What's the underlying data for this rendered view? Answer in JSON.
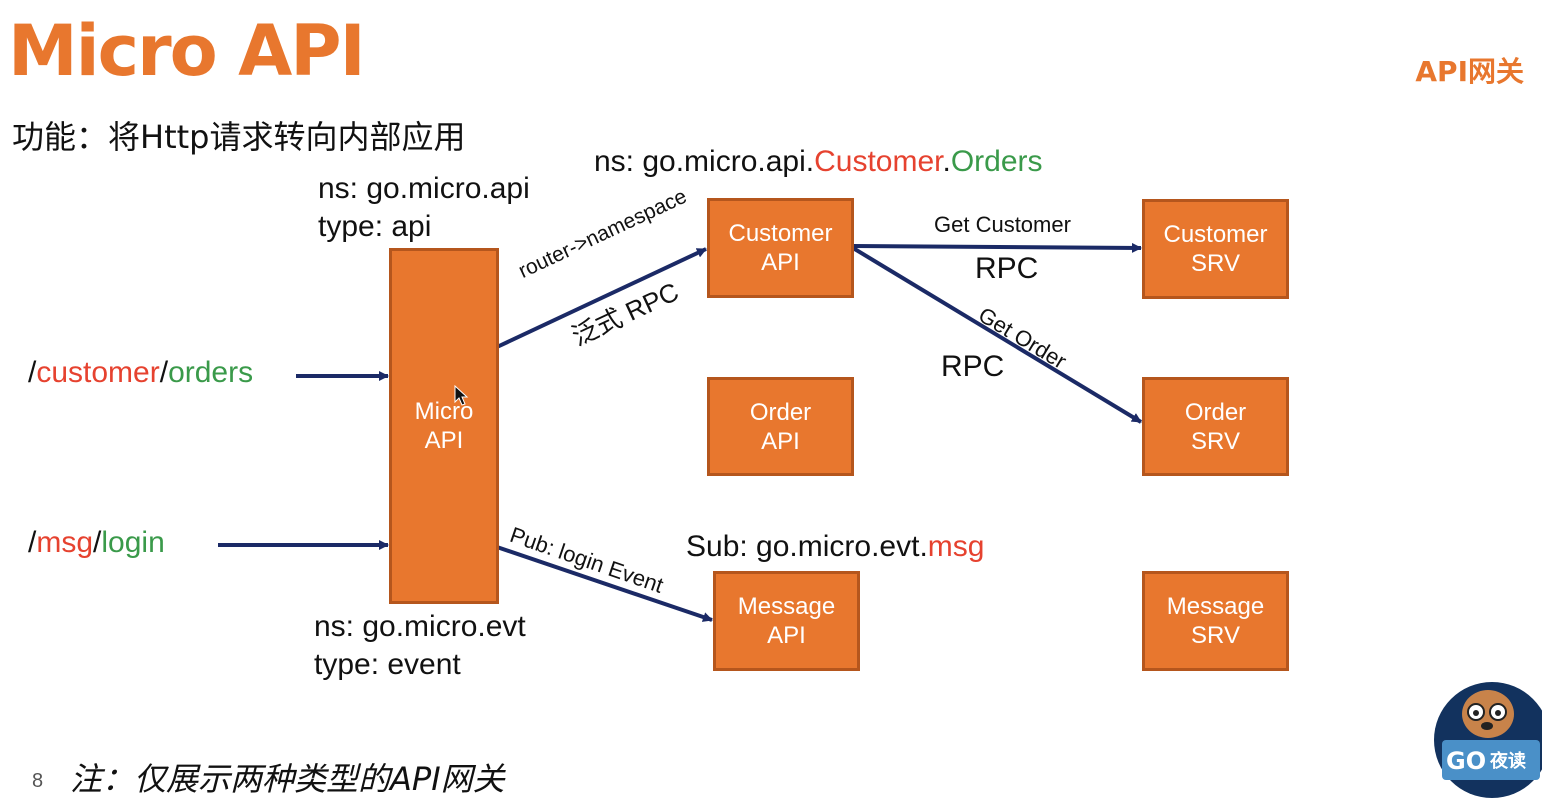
{
  "title": "Micro API",
  "badge": "API网关",
  "function_text": "功能：将Http请求转向内部应用",
  "routes": {
    "customer": {
      "slash1": "/",
      "part1": "customer",
      "slash2": "/",
      "part2": "orders"
    },
    "msg": {
      "slash1": "/",
      "part1": "msg",
      "slash2": "/",
      "part2": "login"
    }
  },
  "api_ns": {
    "ns": "ns: go.micro.api",
    "type": "type: api"
  },
  "evt_ns": {
    "ns": "ns: go.micro.evt",
    "type": "type: event"
  },
  "customer_ns": {
    "prefix": "ns: go.micro.api.",
    "customer": "Customer",
    "dot": ".",
    "orders": "Orders"
  },
  "sub": {
    "prefix": "Sub: go.micro.evt.",
    "msg": "msg"
  },
  "boxes": {
    "micro_api": [
      "Micro",
      "API"
    ],
    "customer_api": [
      "Customer",
      "API"
    ],
    "order_api": [
      "Order",
      "API"
    ],
    "message_api": [
      "Message",
      "API"
    ],
    "customer_srv": [
      "Customer",
      "SRV"
    ],
    "order_srv": [
      "Order",
      "SRV"
    ],
    "message_srv": [
      "Message",
      "SRV"
    ]
  },
  "edges": {
    "router": "router->namespace",
    "generic_rpc": "泛式 RPC",
    "get_customer": "Get Customer",
    "rpc1": "RPC",
    "get_order": "Get Order",
    "rpc2": "RPC",
    "pub": "Pub: login Event"
  },
  "page_number": "8",
  "note": "注：仅展示两种类型的API网关",
  "logo": {
    "text": "GO",
    "text2": "夜读"
  },
  "colors": {
    "orange": "#e8772e",
    "arrow": "#1b2a66",
    "red": "#e6422f",
    "green": "#3a9a4a"
  }
}
